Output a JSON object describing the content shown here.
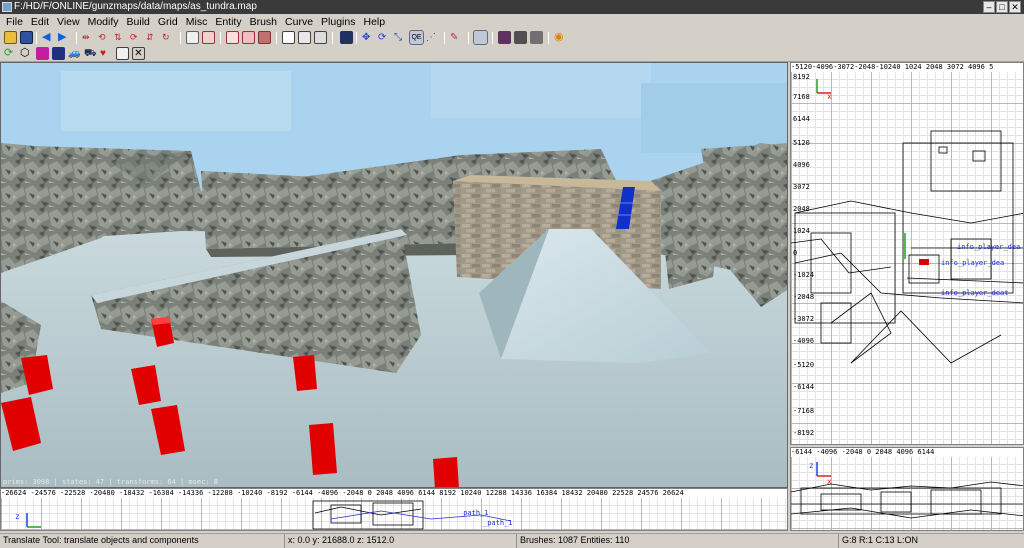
{
  "window": {
    "title": "F:/HD/F/ONLINE/gunzmaps/data/maps/as_tundra.map",
    "min": "–",
    "max": "□",
    "close": "✕"
  },
  "menu": [
    "File",
    "Edit",
    "View",
    "Modify",
    "Build",
    "Grid",
    "Misc",
    "Entity",
    "Brush",
    "Curve",
    "Plugins",
    "Help"
  ],
  "toolbar": {
    "qe_label": "QE"
  },
  "viewport3d": {
    "stats": "prims: 3098 | states: 47 | transforms: 64 | msec: 8"
  },
  "ortho_top_right": {
    "x_ticks": "-5120-4096-3072-2048-10240      1024 2048 3072 4096 5",
    "y_ticks": [
      "8192",
      "7168",
      "6144",
      "5120",
      "4096",
      "3072",
      "2048",
      "1024",
      "0",
      "-1024",
      "-2048",
      "-3072",
      "-4096",
      "-5120",
      "-6144",
      "-7168",
      "-8192"
    ],
    "labels": [
      "info_player_dea",
      "info_player_dea",
      "info_player_deat"
    ]
  },
  "ortho_bottom_right": {
    "x_ticks": "-6144       -4096      -2048      0        2048       4096      6144"
  },
  "ortho_bottom": {
    "x_ticks": "-26624 -24576 -22528 -20480 -18432 -16384 -14336 -12288 -10240 -8192  -6144  -4096  -2048   0    2048   4096   6144   8192   10240  12288  14336  16384  18432  20480  22528  24576  26624",
    "labels": [
      "_path_1",
      "_path_1"
    ]
  },
  "status": {
    "tool": "Translate Tool: translate objects and components",
    "coords": "x:   0.0  y:  21688.0  z:  1512.0",
    "counts": "Brushes: 1087 Entities: 110",
    "grid": "G:8  R:1  C:13  L:ON"
  },
  "colors": {
    "sky": "#a9d3ee",
    "entity_box": "#e00000",
    "blue_brush": "#1030c8",
    "axis_x": "#e02020",
    "axis_y": "#20a020",
    "axis_z": "#2040e0"
  }
}
